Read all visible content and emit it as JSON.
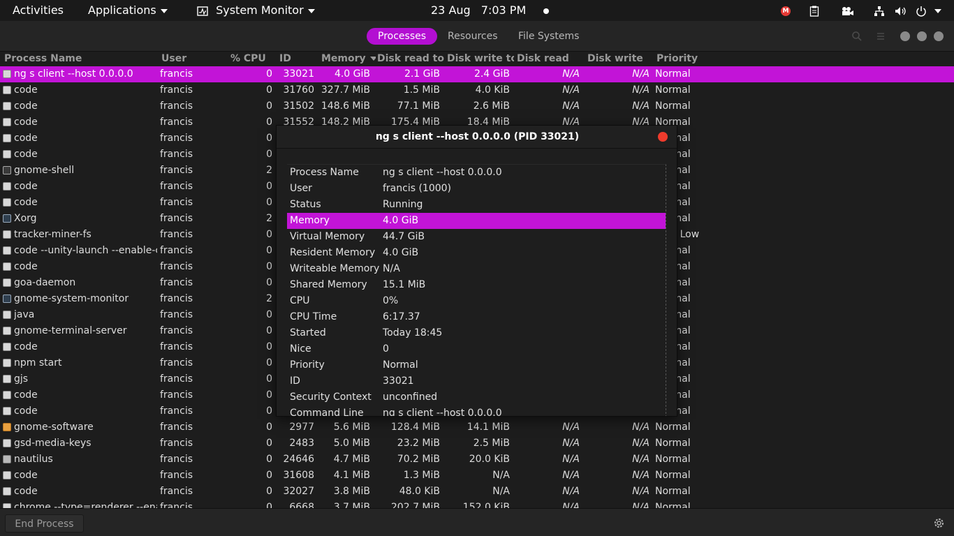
{
  "topbar": {
    "activities": "Activities",
    "applications": "Applications",
    "app_name": "System Monitor",
    "date": "23 Aug",
    "time": "7:03 PM",
    "mega_label": "M"
  },
  "header": {
    "tabs": [
      {
        "label": "Processes"
      },
      {
        "label": "Resources"
      },
      {
        "label": "File Systems"
      }
    ]
  },
  "table": {
    "columns": [
      "Process Name",
      "User",
      "% CPU",
      "ID",
      "Memory",
      "Disk read tota",
      "Disk write tot",
      "Disk read",
      "Disk write",
      "Priority"
    ],
    "rows": [
      {
        "name": "ng s client --host 0.0.0.0",
        "user": "francis",
        "cpu": "0",
        "id": "33021",
        "mem": "4.0 GiB",
        "dr": "2.1 GiB",
        "dw": "2.4 GiB",
        "drr": "N/A",
        "dwr": "N/A",
        "pri": "Normal"
      },
      {
        "name": "code",
        "user": "francis",
        "cpu": "0",
        "id": "31760",
        "mem": "327.7 MiB",
        "dr": "1.5 MiB",
        "dw": "4.0 KiB",
        "drr": "N/A",
        "dwr": "N/A",
        "pri": "Normal"
      },
      {
        "name": "code",
        "user": "francis",
        "cpu": "0",
        "id": "31502",
        "mem": "148.6 MiB",
        "dr": "77.1 MiB",
        "dw": "2.6 MiB",
        "drr": "N/A",
        "dwr": "N/A",
        "pri": "Normal"
      },
      {
        "name": "code",
        "user": "francis",
        "cpu": "0",
        "id": "31552",
        "mem": "148.2 MiB",
        "dr": "175.4 MiB",
        "dw": "18.4 MiB",
        "drr": "N/A",
        "dwr": "N/A",
        "pri": "Normal"
      },
      {
        "name": "code",
        "user": "francis",
        "cpu": "0",
        "id": "",
        "mem": "",
        "dr": "",
        "dw": "",
        "drr": "",
        "dwr": "",
        "pri": "Normal"
      },
      {
        "name": "code",
        "user": "francis",
        "cpu": "0",
        "id": "",
        "mem": "",
        "dr": "",
        "dw": "",
        "drr": "",
        "dwr": "",
        "pri": "Normal"
      },
      {
        "name": "gnome-shell",
        "user": "francis",
        "cpu": "2",
        "id": "",
        "mem": "",
        "dr": "",
        "dw": "",
        "drr": "",
        "dwr": "",
        "pri": "Normal"
      },
      {
        "name": "code",
        "user": "francis",
        "cpu": "0",
        "id": "",
        "mem": "",
        "dr": "",
        "dw": "",
        "drr": "",
        "dwr": "",
        "pri": "Normal"
      },
      {
        "name": "code",
        "user": "francis",
        "cpu": "0",
        "id": "",
        "mem": "",
        "dr": "",
        "dw": "",
        "drr": "",
        "dwr": "",
        "pri": "Normal"
      },
      {
        "name": "Xorg",
        "user": "francis",
        "cpu": "2",
        "id": "",
        "mem": "",
        "dr": "",
        "dw": "",
        "drr": "",
        "dwr": "",
        "pri": "Normal"
      },
      {
        "name": "tracker-miner-fs",
        "user": "francis",
        "cpu": "0",
        "id": "",
        "mem": "",
        "dr": "",
        "dw": "",
        "drr": "",
        "dwr": "",
        "pri": "Very Low"
      },
      {
        "name": "code --unity-launch --enable-cra",
        "user": "francis",
        "cpu": "0",
        "id": "",
        "mem": "",
        "dr": "",
        "dw": "",
        "drr": "",
        "dwr": "",
        "pri": "Normal"
      },
      {
        "name": "code",
        "user": "francis",
        "cpu": "0",
        "id": "",
        "mem": "",
        "dr": "",
        "dw": "",
        "drr": "",
        "dwr": "",
        "pri": "Normal"
      },
      {
        "name": "goa-daemon",
        "user": "francis",
        "cpu": "0",
        "id": "",
        "mem": "",
        "dr": "",
        "dw": "",
        "drr": "",
        "dwr": "",
        "pri": "Normal"
      },
      {
        "name": "gnome-system-monitor",
        "user": "francis",
        "cpu": "2",
        "id": "",
        "mem": "",
        "dr": "",
        "dw": "",
        "drr": "",
        "dwr": "",
        "pri": "Normal"
      },
      {
        "name": "java",
        "user": "francis",
        "cpu": "0",
        "id": "",
        "mem": "",
        "dr": "",
        "dw": "",
        "drr": "",
        "dwr": "",
        "pri": "Normal"
      },
      {
        "name": "gnome-terminal-server",
        "user": "francis",
        "cpu": "0",
        "id": "",
        "mem": "",
        "dr": "",
        "dw": "",
        "drr": "",
        "dwr": "",
        "pri": "Normal"
      },
      {
        "name": "code",
        "user": "francis",
        "cpu": "0",
        "id": "",
        "mem": "",
        "dr": "",
        "dw": "",
        "drr": "",
        "dwr": "",
        "pri": "Normal"
      },
      {
        "name": "npm start",
        "user": "francis",
        "cpu": "0",
        "id": "",
        "mem": "",
        "dr": "",
        "dw": "",
        "drr": "",
        "dwr": "",
        "pri": "Normal"
      },
      {
        "name": "gjs",
        "user": "francis",
        "cpu": "0",
        "id": "",
        "mem": "",
        "dr": "",
        "dw": "",
        "drr": "",
        "dwr": "",
        "pri": "Normal"
      },
      {
        "name": "code",
        "user": "francis",
        "cpu": "0",
        "id": "",
        "mem": "",
        "dr": "",
        "dw": "",
        "drr": "",
        "dwr": "",
        "pri": "Normal"
      },
      {
        "name": "code",
        "user": "francis",
        "cpu": "0",
        "id": "",
        "mem": "",
        "dr": "",
        "dw": "",
        "drr": "",
        "dwr": "",
        "pri": "Normal"
      },
      {
        "name": "gnome-software",
        "user": "francis",
        "cpu": "0",
        "id": "2977",
        "mem": "5.6 MiB",
        "dr": "128.4 MiB",
        "dw": "14.1 MiB",
        "drr": "N/A",
        "dwr": "N/A",
        "pri": "Normal"
      },
      {
        "name": "gsd-media-keys",
        "user": "francis",
        "cpu": "0",
        "id": "2483",
        "mem": "5.0 MiB",
        "dr": "23.2 MiB",
        "dw": "2.5 MiB",
        "drr": "N/A",
        "dwr": "N/A",
        "pri": "Normal"
      },
      {
        "name": "nautilus",
        "user": "francis",
        "cpu": "0",
        "id": "24646",
        "mem": "4.7 MiB",
        "dr": "70.2 MiB",
        "dw": "20.0 KiB",
        "drr": "N/A",
        "dwr": "N/A",
        "pri": "Normal"
      },
      {
        "name": "code",
        "user": "francis",
        "cpu": "0",
        "id": "31608",
        "mem": "4.1 MiB",
        "dr": "1.3 MiB",
        "dw": "N/A",
        "drr": "N/A",
        "dwr": "N/A",
        "pri": "Normal"
      },
      {
        "name": "code",
        "user": "francis",
        "cpu": "0",
        "id": "32027",
        "mem": "3.8 MiB",
        "dr": "48.0 KiB",
        "dw": "N/A",
        "drr": "N/A",
        "dwr": "N/A",
        "pri": "Normal"
      },
      {
        "name": "chrome --type=renderer --enab",
        "user": "francis",
        "cpu": "0",
        "id": "6668",
        "mem": "3.7 MiB",
        "dr": "202.7 MiB",
        "dw": "152.0 KiB",
        "drr": "N/A",
        "dwr": "N/A",
        "pri": "Normal"
      }
    ]
  },
  "dialog": {
    "title": "ng s client --host 0.0.0.0 (PID 33021)",
    "fields": [
      {
        "key": "Process Name",
        "value": "ng s client --host 0.0.0.0"
      },
      {
        "key": "User",
        "value": "francis (1000)"
      },
      {
        "key": "Status",
        "value": "Running"
      },
      {
        "key": "Memory",
        "value": "4.0 GiB"
      },
      {
        "key": "Virtual Memory",
        "value": "44.7 GiB"
      },
      {
        "key": "Resident Memory",
        "value": "4.0 GiB"
      },
      {
        "key": "Writeable Memory",
        "value": "N/A"
      },
      {
        "key": "Shared Memory",
        "value": "15.1 MiB"
      },
      {
        "key": "CPU",
        "value": "0%"
      },
      {
        "key": "CPU Time",
        "value": "6:17.37"
      },
      {
        "key": "Started",
        "value": "Today 18:45"
      },
      {
        "key": "Nice",
        "value": "0"
      },
      {
        "key": "Priority",
        "value": "Normal"
      },
      {
        "key": "ID",
        "value": "33021"
      },
      {
        "key": "Security Context",
        "value": "unconfined"
      },
      {
        "key": "Command Line",
        "value": "ng s client --host 0.0.0.0"
      }
    ]
  },
  "bottom": {
    "end_process": "End Process"
  },
  "colors": {
    "accent": "#c214d7",
    "close": "#ef3b2c"
  }
}
